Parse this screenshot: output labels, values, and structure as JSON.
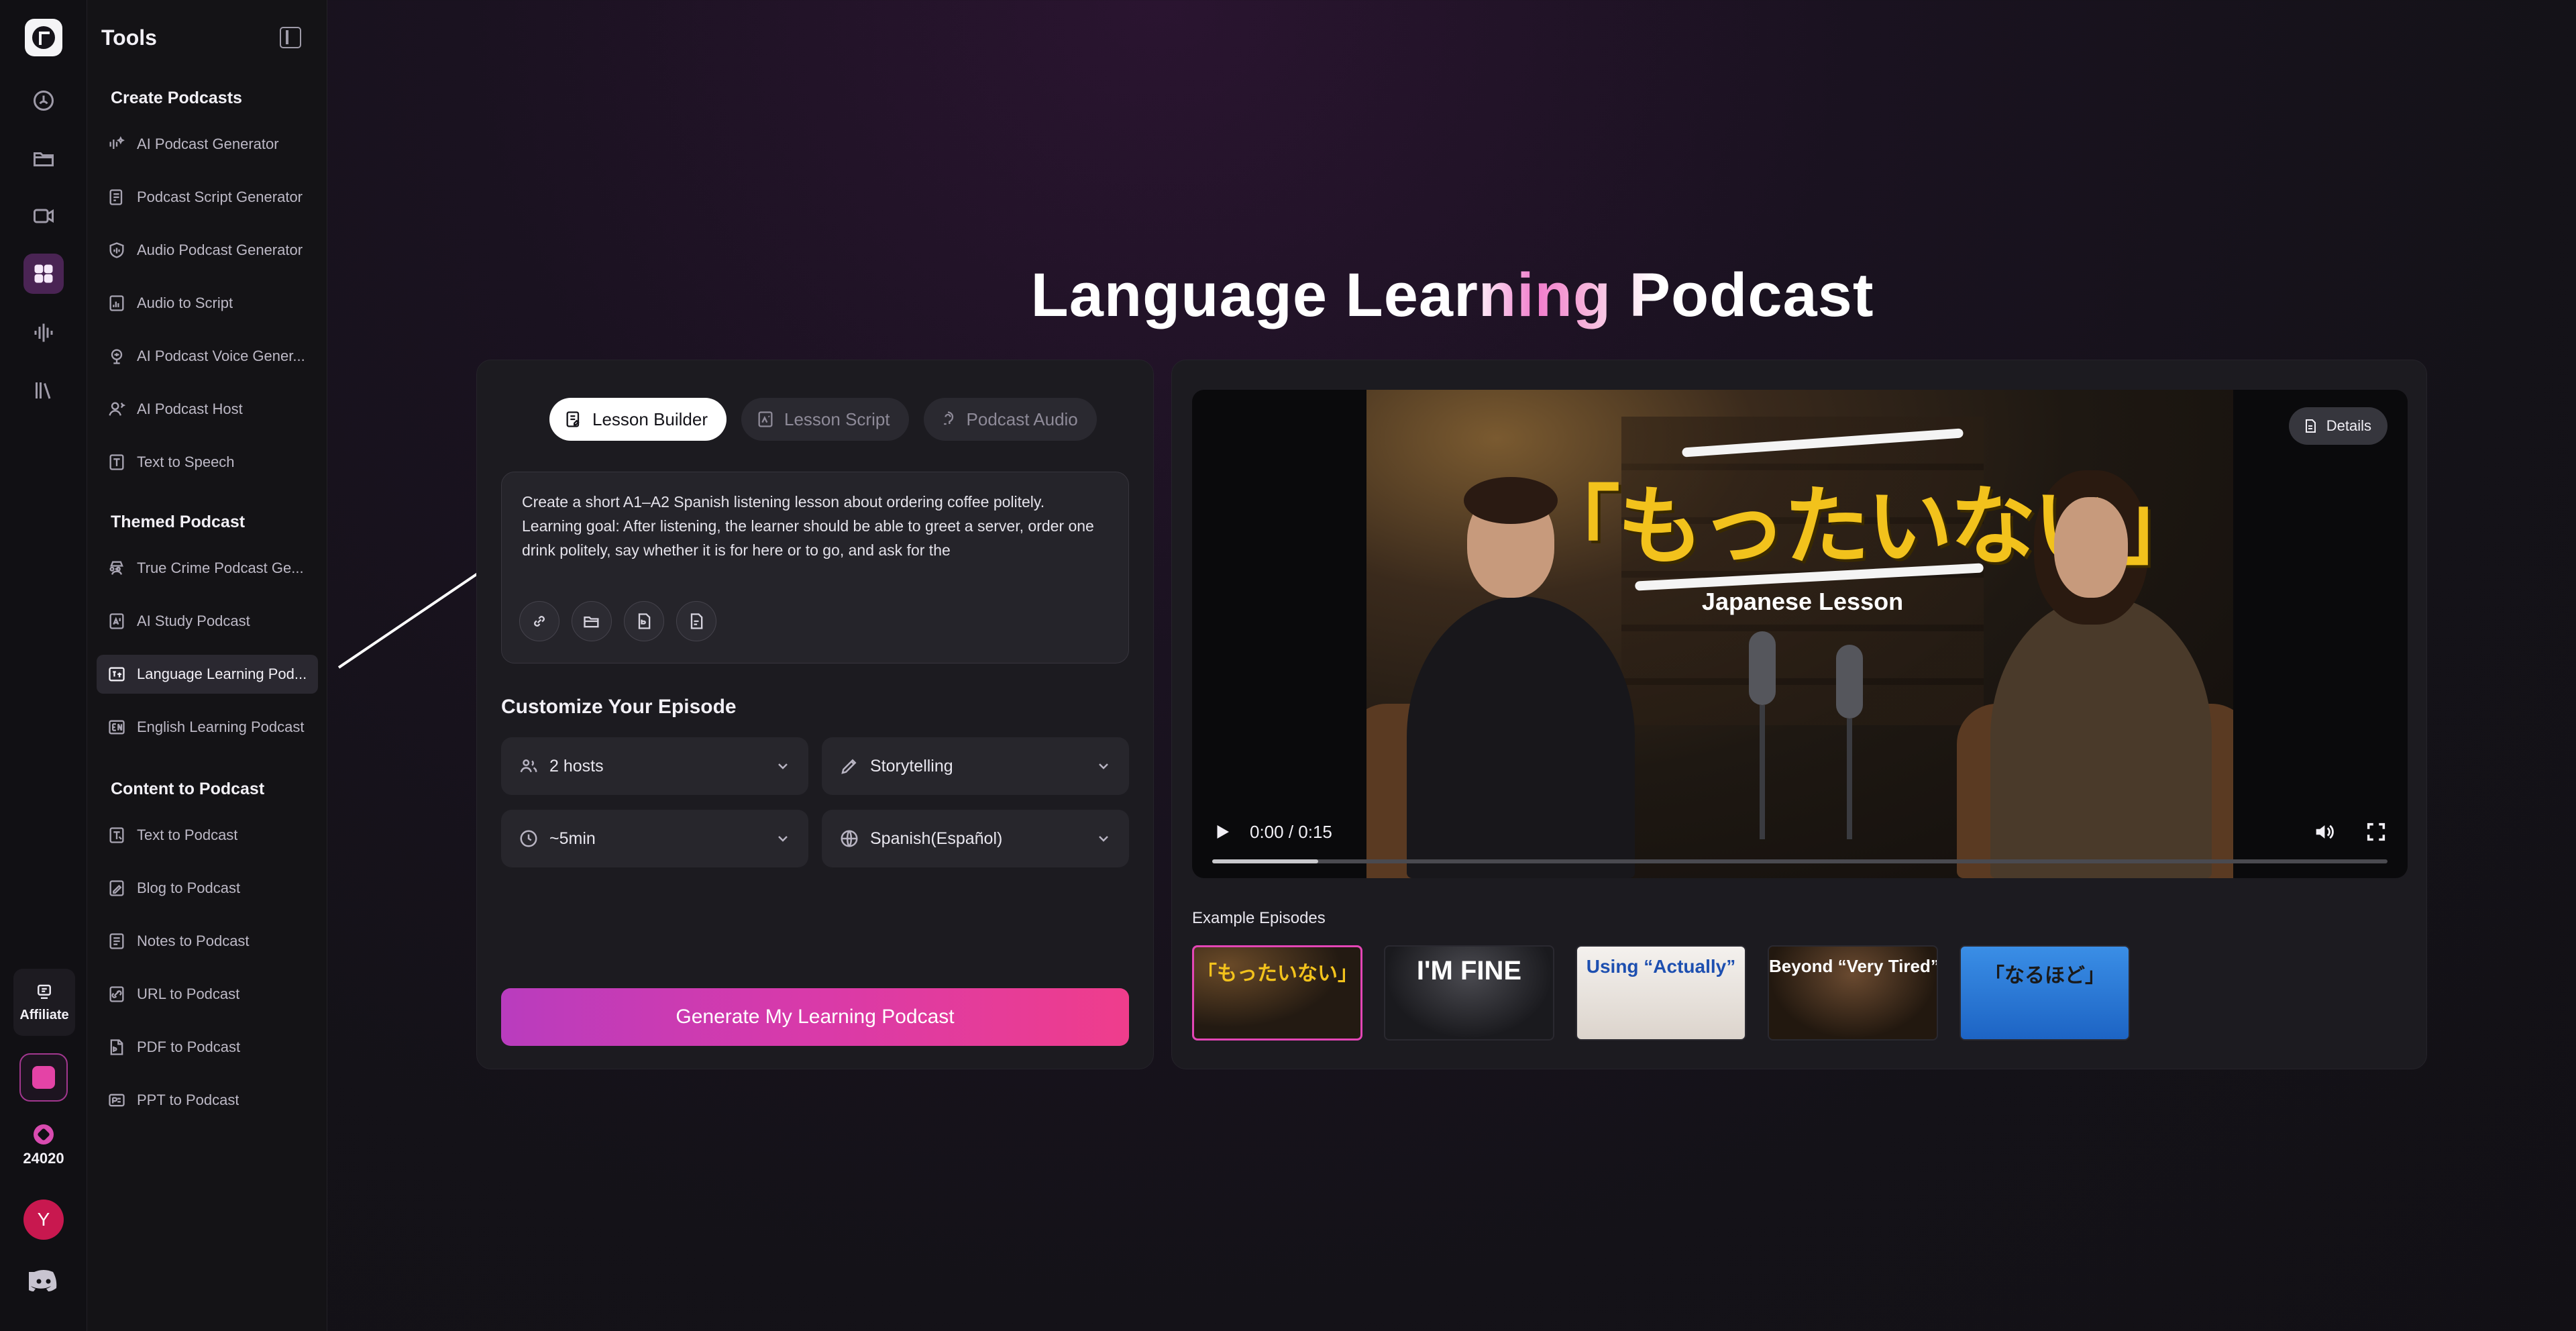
{
  "rail": {
    "affiliate_label": "Affiliate",
    "credits": "24020",
    "avatar_initial": "Y"
  },
  "tools": {
    "title": "Tools",
    "sections": [
      {
        "title": "Create Podcasts",
        "items": [
          {
            "label": "AI Podcast Generator",
            "icon": "sparkle-wave-icon"
          },
          {
            "label": "Podcast Script Generator",
            "icon": "script-icon"
          },
          {
            "label": "Audio Podcast Generator",
            "icon": "audio-shield-icon"
          },
          {
            "label": "Audio to Script",
            "icon": "audio-script-icon"
          },
          {
            "label": "AI Podcast Voice Gener...",
            "icon": "mic-voice-icon"
          },
          {
            "label": "AI Podcast Host",
            "icon": "host-icon"
          },
          {
            "label": "Text to Speech",
            "icon": "text-speech-icon"
          }
        ]
      },
      {
        "title": "Themed Podcast",
        "items": [
          {
            "label": "True Crime Podcast Ge...",
            "icon": "detective-icon"
          },
          {
            "label": "AI Study Podcast",
            "icon": "study-icon"
          },
          {
            "label": "Language Learning Pod...",
            "icon": "language-icon",
            "active": true
          },
          {
            "label": "English Learning Podcast",
            "icon": "english-icon"
          }
        ]
      },
      {
        "title": "Content to Podcast",
        "items": [
          {
            "label": "Text to Podcast",
            "icon": "text-doc-icon"
          },
          {
            "label": "Blog to Podcast",
            "icon": "blog-icon"
          },
          {
            "label": "Notes to Podcast",
            "icon": "notes-icon"
          },
          {
            "label": "URL to Podcast",
            "icon": "url-icon"
          },
          {
            "label": "PDF to Podcast",
            "icon": "pdf-icon"
          },
          {
            "label": "PPT to Podcast",
            "icon": "ppt-icon"
          }
        ]
      }
    ]
  },
  "main": {
    "title": "Language Learning Podcast",
    "tabs": [
      {
        "label": "Lesson Builder",
        "active": true
      },
      {
        "label": "Lesson Script",
        "active": false
      },
      {
        "label": "Podcast Audio",
        "active": false
      }
    ],
    "prompt": {
      "line1": "Create a short A1–A2 Spanish listening lesson about ordering coffee politely.",
      "line2": "Learning goal: After listening, the learner should be able to greet a server, order one drink politely, say whether it is for here or to go, and ask for the"
    },
    "customize_title": "Customize Your Episode",
    "options": {
      "hosts": "2 hosts",
      "style": "Storytelling",
      "duration": "~5min",
      "language": "Spanish(Español)"
    },
    "generate_label": "Generate My Learning Podcast"
  },
  "player": {
    "details_label": "Details",
    "overlay_title": "「もったいない」",
    "overlay_subtitle": "Japanese Lesson",
    "time": "0:00 / 0:15",
    "progress": 0.09
  },
  "examples": {
    "title": "Example Episodes",
    "items": [
      {
        "label": "「もったいない」",
        "active": true
      },
      {
        "label": "I'M FINE",
        "active": false
      },
      {
        "label": "Using “Actually”",
        "active": false
      },
      {
        "label": "Beyond “Very Tired”",
        "active": false
      },
      {
        "label": "「なるほど」",
        "active": false
      }
    ]
  },
  "colors": {
    "accent_start": "#b93cbe",
    "accent_end": "#ef3d8c",
    "active_rail": "#4a2454",
    "overlay_yellow": "#f2c21c"
  }
}
